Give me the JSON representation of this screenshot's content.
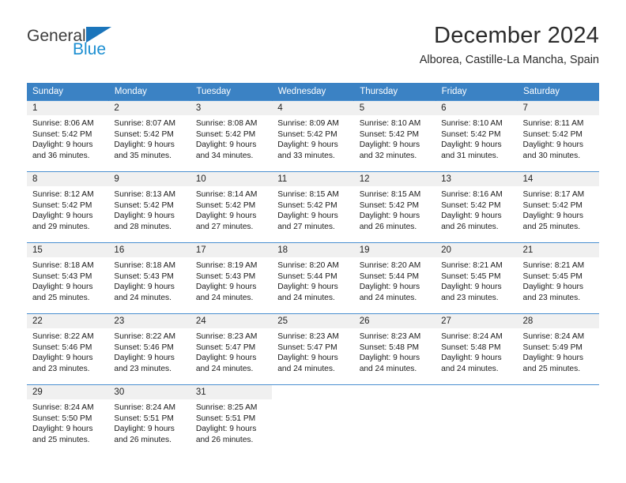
{
  "brand": {
    "name_part1": "General",
    "name_part2": "Blue",
    "logo_icon": "blue-triangle-logo",
    "accent_color": "#1b75bb",
    "secondary_color": "#1b8ed1"
  },
  "header": {
    "title": "December 2024",
    "subtitle": "Alborea, Castille-La Mancha, Spain"
  },
  "theme": {
    "header_bg": "#3b82c4",
    "daynum_bg": "#f0f0f0",
    "row_border": "#4a8fd0"
  },
  "weekday_headers": [
    "Sunday",
    "Monday",
    "Tuesday",
    "Wednesday",
    "Thursday",
    "Friday",
    "Saturday"
  ],
  "weeks": [
    [
      {
        "day": "1",
        "sunrise": "Sunrise: 8:06 AM",
        "sunset": "Sunset: 5:42 PM",
        "daylight_line1": "Daylight: 9 hours",
        "daylight_line2": "and 36 minutes."
      },
      {
        "day": "2",
        "sunrise": "Sunrise: 8:07 AM",
        "sunset": "Sunset: 5:42 PM",
        "daylight_line1": "Daylight: 9 hours",
        "daylight_line2": "and 35 minutes."
      },
      {
        "day": "3",
        "sunrise": "Sunrise: 8:08 AM",
        "sunset": "Sunset: 5:42 PM",
        "daylight_line1": "Daylight: 9 hours",
        "daylight_line2": "and 34 minutes."
      },
      {
        "day": "4",
        "sunrise": "Sunrise: 8:09 AM",
        "sunset": "Sunset: 5:42 PM",
        "daylight_line1": "Daylight: 9 hours",
        "daylight_line2": "and 33 minutes."
      },
      {
        "day": "5",
        "sunrise": "Sunrise: 8:10 AM",
        "sunset": "Sunset: 5:42 PM",
        "daylight_line1": "Daylight: 9 hours",
        "daylight_line2": "and 32 minutes."
      },
      {
        "day": "6",
        "sunrise": "Sunrise: 8:10 AM",
        "sunset": "Sunset: 5:42 PM",
        "daylight_line1": "Daylight: 9 hours",
        "daylight_line2": "and 31 minutes."
      },
      {
        "day": "7",
        "sunrise": "Sunrise: 8:11 AM",
        "sunset": "Sunset: 5:42 PM",
        "daylight_line1": "Daylight: 9 hours",
        "daylight_line2": "and 30 minutes."
      }
    ],
    [
      {
        "day": "8",
        "sunrise": "Sunrise: 8:12 AM",
        "sunset": "Sunset: 5:42 PM",
        "daylight_line1": "Daylight: 9 hours",
        "daylight_line2": "and 29 minutes."
      },
      {
        "day": "9",
        "sunrise": "Sunrise: 8:13 AM",
        "sunset": "Sunset: 5:42 PM",
        "daylight_line1": "Daylight: 9 hours",
        "daylight_line2": "and 28 minutes."
      },
      {
        "day": "10",
        "sunrise": "Sunrise: 8:14 AM",
        "sunset": "Sunset: 5:42 PM",
        "daylight_line1": "Daylight: 9 hours",
        "daylight_line2": "and 27 minutes."
      },
      {
        "day": "11",
        "sunrise": "Sunrise: 8:15 AM",
        "sunset": "Sunset: 5:42 PM",
        "daylight_line1": "Daylight: 9 hours",
        "daylight_line2": "and 27 minutes."
      },
      {
        "day": "12",
        "sunrise": "Sunrise: 8:15 AM",
        "sunset": "Sunset: 5:42 PM",
        "daylight_line1": "Daylight: 9 hours",
        "daylight_line2": "and 26 minutes."
      },
      {
        "day": "13",
        "sunrise": "Sunrise: 8:16 AM",
        "sunset": "Sunset: 5:42 PM",
        "daylight_line1": "Daylight: 9 hours",
        "daylight_line2": "and 26 minutes."
      },
      {
        "day": "14",
        "sunrise": "Sunrise: 8:17 AM",
        "sunset": "Sunset: 5:42 PM",
        "daylight_line1": "Daylight: 9 hours",
        "daylight_line2": "and 25 minutes."
      }
    ],
    [
      {
        "day": "15",
        "sunrise": "Sunrise: 8:18 AM",
        "sunset": "Sunset: 5:43 PM",
        "daylight_line1": "Daylight: 9 hours",
        "daylight_line2": "and 25 minutes."
      },
      {
        "day": "16",
        "sunrise": "Sunrise: 8:18 AM",
        "sunset": "Sunset: 5:43 PM",
        "daylight_line1": "Daylight: 9 hours",
        "daylight_line2": "and 24 minutes."
      },
      {
        "day": "17",
        "sunrise": "Sunrise: 8:19 AM",
        "sunset": "Sunset: 5:43 PM",
        "daylight_line1": "Daylight: 9 hours",
        "daylight_line2": "and 24 minutes."
      },
      {
        "day": "18",
        "sunrise": "Sunrise: 8:20 AM",
        "sunset": "Sunset: 5:44 PM",
        "daylight_line1": "Daylight: 9 hours",
        "daylight_line2": "and 24 minutes."
      },
      {
        "day": "19",
        "sunrise": "Sunrise: 8:20 AM",
        "sunset": "Sunset: 5:44 PM",
        "daylight_line1": "Daylight: 9 hours",
        "daylight_line2": "and 24 minutes."
      },
      {
        "day": "20",
        "sunrise": "Sunrise: 8:21 AM",
        "sunset": "Sunset: 5:45 PM",
        "daylight_line1": "Daylight: 9 hours",
        "daylight_line2": "and 23 minutes."
      },
      {
        "day": "21",
        "sunrise": "Sunrise: 8:21 AM",
        "sunset": "Sunset: 5:45 PM",
        "daylight_line1": "Daylight: 9 hours",
        "daylight_line2": "and 23 minutes."
      }
    ],
    [
      {
        "day": "22",
        "sunrise": "Sunrise: 8:22 AM",
        "sunset": "Sunset: 5:46 PM",
        "daylight_line1": "Daylight: 9 hours",
        "daylight_line2": "and 23 minutes."
      },
      {
        "day": "23",
        "sunrise": "Sunrise: 8:22 AM",
        "sunset": "Sunset: 5:46 PM",
        "daylight_line1": "Daylight: 9 hours",
        "daylight_line2": "and 23 minutes."
      },
      {
        "day": "24",
        "sunrise": "Sunrise: 8:23 AM",
        "sunset": "Sunset: 5:47 PM",
        "daylight_line1": "Daylight: 9 hours",
        "daylight_line2": "and 24 minutes."
      },
      {
        "day": "25",
        "sunrise": "Sunrise: 8:23 AM",
        "sunset": "Sunset: 5:47 PM",
        "daylight_line1": "Daylight: 9 hours",
        "daylight_line2": "and 24 minutes."
      },
      {
        "day": "26",
        "sunrise": "Sunrise: 8:23 AM",
        "sunset": "Sunset: 5:48 PM",
        "daylight_line1": "Daylight: 9 hours",
        "daylight_line2": "and 24 minutes."
      },
      {
        "day": "27",
        "sunrise": "Sunrise: 8:24 AM",
        "sunset": "Sunset: 5:48 PM",
        "daylight_line1": "Daylight: 9 hours",
        "daylight_line2": "and 24 minutes."
      },
      {
        "day": "28",
        "sunrise": "Sunrise: 8:24 AM",
        "sunset": "Sunset: 5:49 PM",
        "daylight_line1": "Daylight: 9 hours",
        "daylight_line2": "and 25 minutes."
      }
    ],
    [
      {
        "day": "29",
        "sunrise": "Sunrise: 8:24 AM",
        "sunset": "Sunset: 5:50 PM",
        "daylight_line1": "Daylight: 9 hours",
        "daylight_line2": "and 25 minutes."
      },
      {
        "day": "30",
        "sunrise": "Sunrise: 8:24 AM",
        "sunset": "Sunset: 5:51 PM",
        "daylight_line1": "Daylight: 9 hours",
        "daylight_line2": "and 26 minutes."
      },
      {
        "day": "31",
        "sunrise": "Sunrise: 8:25 AM",
        "sunset": "Sunset: 5:51 PM",
        "daylight_line1": "Daylight: 9 hours",
        "daylight_line2": "and 26 minutes."
      },
      {
        "day": "",
        "sunrise": "",
        "sunset": "",
        "daylight_line1": "",
        "daylight_line2": ""
      },
      {
        "day": "",
        "sunrise": "",
        "sunset": "",
        "daylight_line1": "",
        "daylight_line2": ""
      },
      {
        "day": "",
        "sunrise": "",
        "sunset": "",
        "daylight_line1": "",
        "daylight_line2": ""
      },
      {
        "day": "",
        "sunrise": "",
        "sunset": "",
        "daylight_line1": "",
        "daylight_line2": ""
      }
    ]
  ]
}
